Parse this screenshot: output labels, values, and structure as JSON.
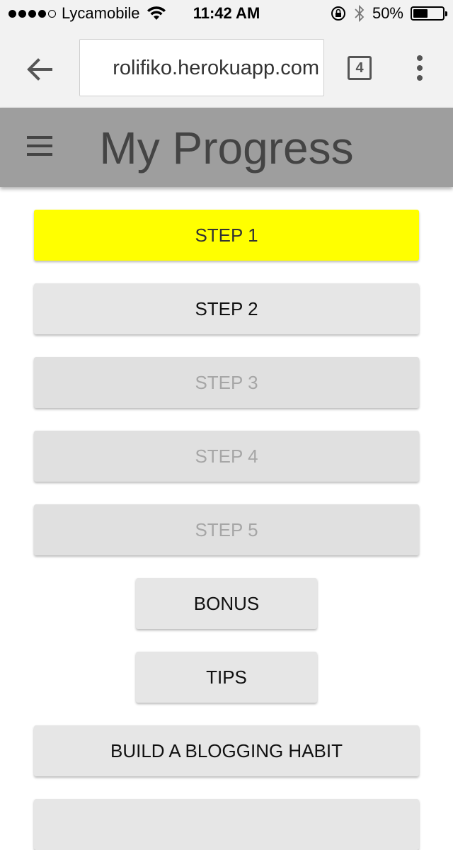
{
  "status_bar": {
    "carrier": "Lycamobile",
    "time": "11:42 AM",
    "battery": "50%",
    "battery_level": 0.5
  },
  "browser": {
    "url": "rolifiko.herokuapp.com",
    "tab_count": "4"
  },
  "header": {
    "title": "My Progress"
  },
  "buttons": {
    "step1": "STEP 1",
    "step2": "STEP 2",
    "step3": "STEP 3",
    "step4": "STEP 4",
    "step5": "STEP 5",
    "bonus": "BONUS",
    "tips": "TIPS",
    "blogging": "BUILD A BLOGGING HABIT"
  },
  "colors": {
    "active_step": "#ffff00",
    "header_bg": "#9e9e9e",
    "button_bg": "#e6e6e6"
  }
}
